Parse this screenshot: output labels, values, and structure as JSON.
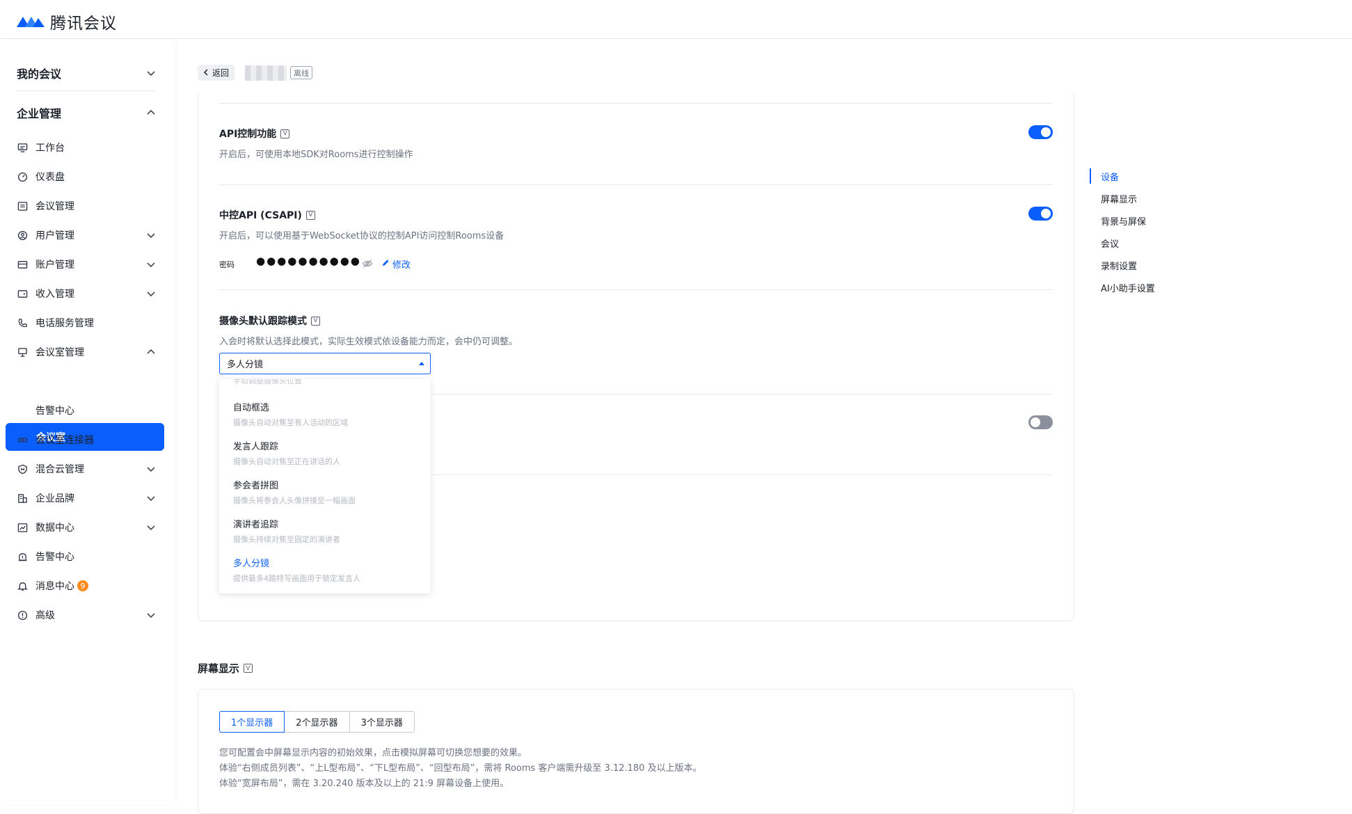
{
  "header": {
    "app_name": "腾讯会议"
  },
  "sidebar": {
    "my_meetings": "我的会议",
    "enterprise": "企业管理",
    "items": [
      {
        "label": "工作台"
      },
      {
        "label": "仪表盘"
      },
      {
        "label": "会议管理"
      },
      {
        "label": "用户管理"
      },
      {
        "label": "账户管理"
      },
      {
        "label": "收入管理"
      },
      {
        "label": "电话服务管理"
      },
      {
        "label": "会议室管理"
      },
      {
        "label": "会议室"
      },
      {
        "label": "告警中心"
      },
      {
        "label": "会议室连接器"
      },
      {
        "label": "混合云管理"
      },
      {
        "label": "企业品牌"
      },
      {
        "label": "数据中心"
      },
      {
        "label": "告警中心"
      },
      {
        "label": "消息中心"
      },
      {
        "label": "高级"
      }
    ],
    "message_badge": "9"
  },
  "breadcrumb": {
    "back": "返回",
    "status": "离线"
  },
  "settings": {
    "api_control": {
      "title": "API控制功能",
      "tag": "V",
      "desc": "开启后，可使用本地SDK对Rooms进行控制操作",
      "enabled": true
    },
    "csapi": {
      "title": "中控API (CSAPI)",
      "tag": "V",
      "desc": "开启后，可以使用基于WebSocket协议的控制API访问控制Rooms设备",
      "enabled": true,
      "password_label": "密码",
      "password_mask": "●●●●●●●●●●",
      "edit": "修改"
    },
    "camera": {
      "title": "摄像头默认跟踪模式",
      "tag": "V",
      "desc": "入会时将默认选择此模式，实际生效模式依设备能力而定，会中仍可调整。",
      "selected": "多人分镜",
      "clipped_hint": "手动调整摄像头位置",
      "options": [
        {
          "title": "自动框选",
          "desc": "摄像头自动对焦至有人活动的区域"
        },
        {
          "title": "发言人跟踪",
          "desc": "摄像头自动对焦至正在讲话的人"
        },
        {
          "title": "参会者拼图",
          "desc": "摄像头将参会人头像拼接至一幅画面"
        },
        {
          "title": "演讲者追踪",
          "desc": "摄像头持续对焦至固定的演讲者"
        },
        {
          "title": "多人分镜",
          "desc": "提供最多4路特写画面用于锁定发言人"
        }
      ]
    },
    "hidden_toggle": {
      "enabled": false
    }
  },
  "anchor_nav": [
    {
      "label": "设备",
      "active": true
    },
    {
      "label": "屏幕显示"
    },
    {
      "label": "背景与屏保"
    },
    {
      "label": "会议"
    },
    {
      "label": "录制设置"
    },
    {
      "label": "AI小助手设置"
    }
  ],
  "screen_display": {
    "title": "屏幕显示",
    "tag": "V",
    "tabs": [
      {
        "label": "1个显示器",
        "active": true
      },
      {
        "label": "2个显示器"
      },
      {
        "label": "3个显示器"
      }
    ],
    "notes": [
      "您可配置会中屏幕显示内容的初始效果，点击模拟屏幕可切换您想要的效果。",
      "体验“右侧成员列表”、“上L型布局”、“下L型布局”、“回型布局”，需将 Rooms 客户端需升级至 3.12.180 及以上版本。",
      "体验“宽屏布局”，需在 3.20.240 版本及以上的 21:9 屏幕设备上使用。"
    ]
  },
  "colors": {
    "accent": "#0a5efb",
    "badge": "#ff8b1f",
    "toggle_off": "#8b909c"
  }
}
